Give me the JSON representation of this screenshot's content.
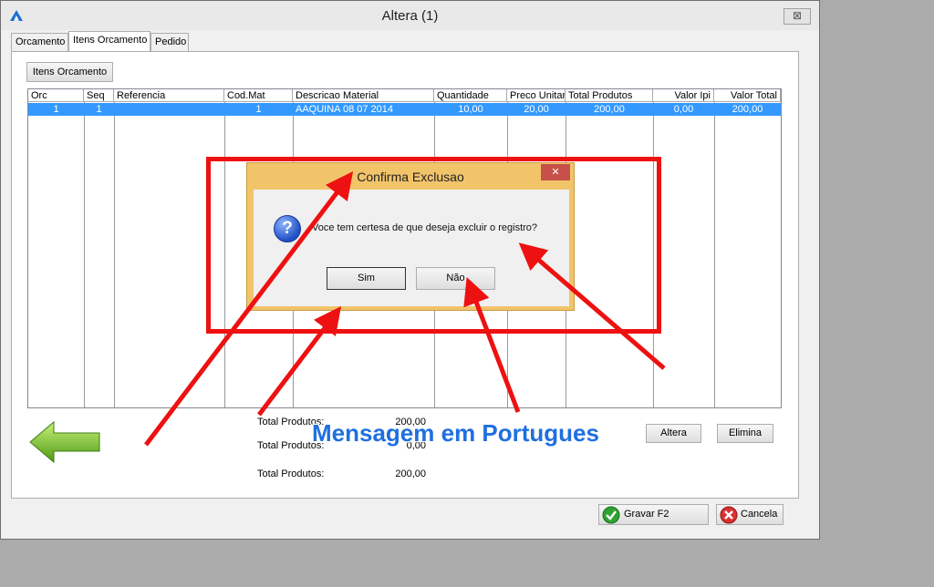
{
  "window": {
    "title": "Altera  (1)",
    "close_glyph": "⊠"
  },
  "tabs": [
    {
      "label": "Orcamento",
      "active": false
    },
    {
      "label": "Itens Orcamento",
      "active": true
    },
    {
      "label": "Pedido",
      "active": false
    }
  ],
  "toolbar": {
    "itens_button": "Itens Orcamento"
  },
  "grid": {
    "columns": [
      "Orc",
      "Seq",
      "Referencia",
      "Cod.Mat",
      "Descricao Material",
      "Quantidade",
      "Preco Unitario",
      "Total Produtos",
      "Valor Ipi",
      "Valor Total"
    ],
    "rows": [
      [
        "1",
        "1",
        "",
        "1",
        "AAQUINA 08 07 2014",
        "10,00",
        "20,00",
        "200,00",
        "0,00",
        "200,00"
      ]
    ],
    "selected_color": "#3399ff"
  },
  "totals": [
    {
      "label": "Total Produtos:",
      "value": "200,00"
    },
    {
      "label": "Total Produtos:",
      "value": "0,00"
    },
    {
      "label": "Total Produtos:",
      "value": "200,00"
    }
  ],
  "actions": {
    "altera": "Altera",
    "elimina": "Elimina"
  },
  "footer": {
    "gravar": "Gravar F2",
    "cancela": "Cancela"
  },
  "dialog": {
    "title": "Confirma Exclusao",
    "message": "Voce tem certesa de que deseja excluir o registro?",
    "yes": "Sim",
    "no": "Não",
    "close_glyph": "✕",
    "icon": "question-icon",
    "bg_color": "#f2c46a"
  },
  "annotation": {
    "text": "Mensagem em Portugues",
    "color": "#1f6fe0",
    "highlight_color": "#ee1111"
  }
}
